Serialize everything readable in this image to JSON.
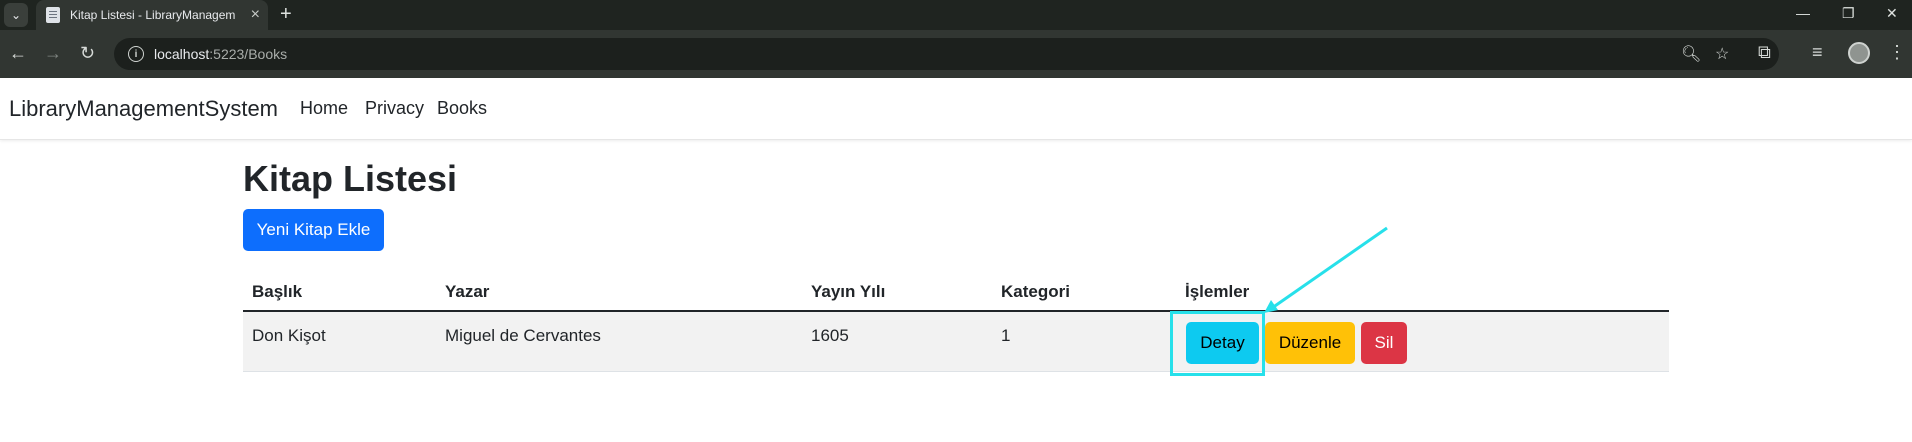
{
  "browser": {
    "tab_title": "Kitap Listesi - LibraryManagem",
    "url_host": "localhost",
    "url_path": ":5223/Books",
    "icons": [
      "tab-search-icon",
      "page-icon",
      "close-icon",
      "plus-icon",
      "minimize-icon",
      "restore-icon",
      "window-close-icon",
      "back-icon",
      "forward-icon",
      "reload-icon",
      "site-info-icon",
      "zoom-icon",
      "star-icon",
      "extensions-icon",
      "media-icon",
      "profile-icon",
      "menu-icon"
    ]
  },
  "navbar": {
    "brand": "LibraryManagementSystem",
    "links": [
      "Home",
      "Privacy",
      "Books"
    ]
  },
  "main": {
    "title": "Kitap Listesi",
    "add_button": "Yeni Kitap Ekle",
    "table": {
      "headers": [
        "Başlık",
        "Yazar",
        "Yayın Yılı",
        "Kategori",
        "İşlemler"
      ],
      "rows": [
        {
          "title": "Don Kişot",
          "author": "Miguel de Cervantes",
          "year": "1605",
          "category": "1",
          "actions": {
            "detail": "Detay",
            "edit": "Düzenle",
            "delete": "Sil"
          }
        }
      ]
    }
  },
  "colors": {
    "primary": "#0d6efd",
    "info": "#0dcaf0",
    "warning": "#ffc107",
    "danger": "#dc3545",
    "annotation": "#27e0ea"
  }
}
